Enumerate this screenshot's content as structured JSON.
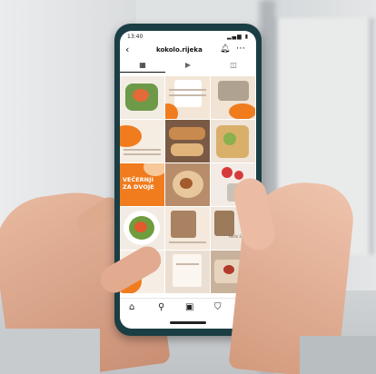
{
  "status_bar": {
    "time": "13:40",
    "icons": "▂▄▆ ▮"
  },
  "header": {
    "username": "kokolo.rijeka",
    "back_icon": "chevron-left-icon",
    "bell_icon": "bell-icon",
    "more_icon": "more-icon"
  },
  "tabs": [
    {
      "name": "grid-icon",
      "glyph": "▦",
      "active": true
    },
    {
      "name": "reels-icon",
      "glyph": "▶",
      "active": false
    },
    {
      "name": "tagged-icon",
      "glyph": "◫",
      "active": false
    }
  ],
  "grid_promo_text": "VEČERNJI\nZA DVOJE",
  "grid_script_label": "Hello Summer",
  "nav": {
    "home": "⌂",
    "search": "⚲",
    "reels": "▣",
    "shop": "⛉"
  },
  "colors": {
    "accent": "#f07c1e",
    "phone_frame": "#1a3e44",
    "cream": "#f4e6d6",
    "food_green": "#5c8a3a"
  }
}
